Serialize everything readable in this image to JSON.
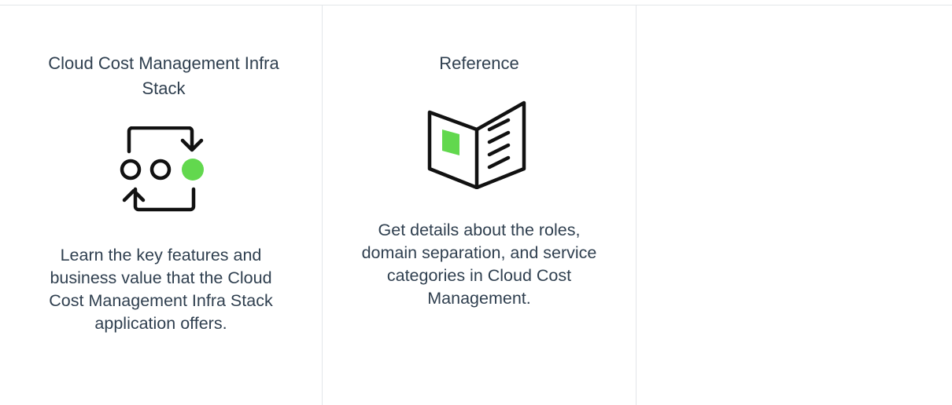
{
  "cards": [
    {
      "title": "Cloud Cost Management Infra Stack",
      "icon": "cycle-process-icon",
      "description": "Learn the key features and business value that the Cloud Cost Management Infra Stack application offers."
    },
    {
      "title": "Reference",
      "icon": "open-book-icon",
      "description": "Get details about the roles, domain separation, and service categories in Cloud Cost Management."
    }
  ],
  "colors": {
    "accent": "#62d84e",
    "text": "#2f3f4f",
    "icon_stroke": "#111111",
    "divider": "#e3e6e9"
  }
}
